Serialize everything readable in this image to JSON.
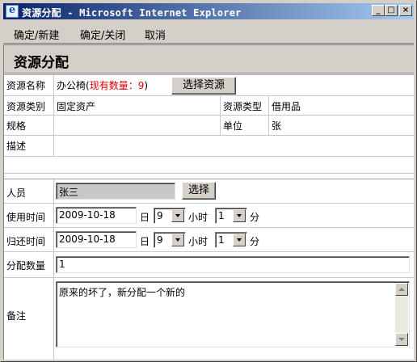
{
  "window": {
    "title": "资源分配 - Microsoft Internet Explorer",
    "minimize_glyph": "_",
    "maximize_glyph": "□",
    "close_glyph": "×"
  },
  "menu": {
    "items": [
      "确定/新建",
      "确定/关闭",
      "取消"
    ]
  },
  "page": {
    "title": "资源分配"
  },
  "form": {
    "resource_name": {
      "label": "资源名称",
      "value": "办公椅",
      "paren_open": "(",
      "stock_text": "现有数量：9",
      "paren_close": ")",
      "button": "选择资源"
    },
    "resource_category": {
      "label": "资源类别",
      "value": "固定资产"
    },
    "resource_type": {
      "label": "资源类型",
      "value": "借用品"
    },
    "spec": {
      "label": "规格",
      "value": ""
    },
    "unit": {
      "label": "单位",
      "value": "张"
    },
    "description": {
      "label": "描述",
      "value": ""
    },
    "person": {
      "label": "人员",
      "value": "张三",
      "button": "选择"
    },
    "use_time": {
      "label": "使用时间",
      "date": "2009-10-18",
      "day_unit": "日",
      "hour": "9",
      "hour_unit": "小时",
      "minute": "1",
      "minute_unit": "分"
    },
    "return_time": {
      "label": "归还时间",
      "date": "2009-10-18",
      "day_unit": "日",
      "hour": "9",
      "hour_unit": "小时",
      "minute": "1",
      "minute_unit": "分"
    },
    "quantity": {
      "label": "分配数量",
      "value": "1"
    },
    "remark": {
      "label": "备注",
      "value": "原来的坏了，新分配一个新的"
    }
  },
  "colors": {
    "title_gradient_start": "#0a246a",
    "title_gradient_end": "#a6caf0",
    "stock_text": "#e00000",
    "chrome": "#d4d0c8"
  }
}
